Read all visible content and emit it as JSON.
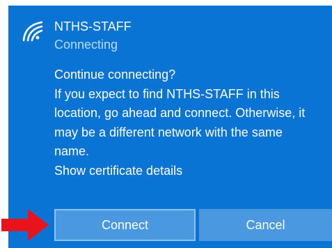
{
  "dialog": {
    "network_name": "NTHS-STAFF",
    "status": "Connecting",
    "message_lines": [
      "Continue connecting?",
      "If you expect to find NTHS-STAFF in this",
      "location, go ahead and connect. Otherwise, it",
      "may be a different network with the same",
      "name."
    ],
    "show_certificate_label": "Show certificate details",
    "connect_label": "Connect",
    "cancel_label": "Cancel"
  },
  "icons": {
    "wifi": "wifi-signal-icon",
    "arrow": "red-arrow-pointer"
  },
  "colors": {
    "panel_background": "#0a74d4",
    "button_background": "#4a98e0",
    "button_focus_border": "#8ec2f2",
    "status_text": "#b9dcff",
    "arrow": "#e8131b"
  }
}
